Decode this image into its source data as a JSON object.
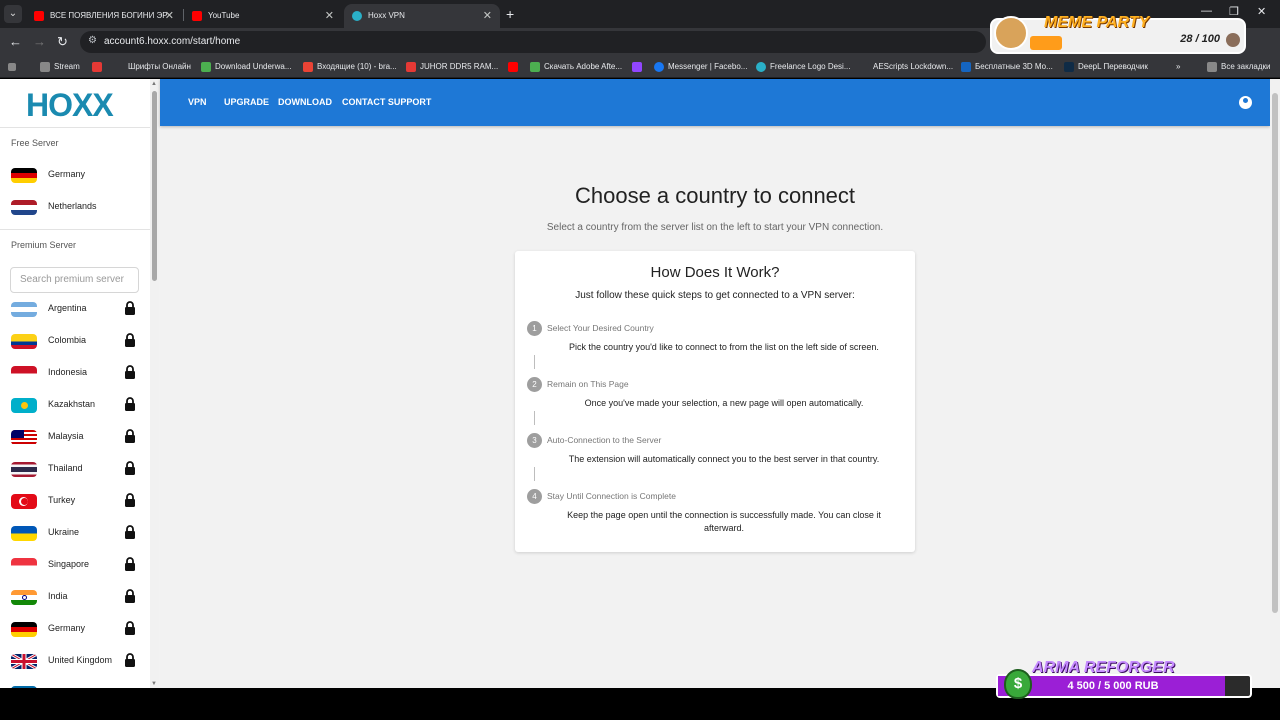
{
  "browser": {
    "tabs": [
      {
        "label": "ВСЕ ПОЯВЛЕНИЯ БОГИНИ ЭР",
        "fav_color": "#ff0000"
      },
      {
        "label": "YouTube",
        "fav_color": "#ff0000"
      },
      {
        "label": "Hoxx VPN",
        "fav_color": "#2ab0c8"
      }
    ],
    "url": "account6.hoxx.com/start/home",
    "bookmarks": [
      {
        "label": "Stream",
        "color": "#888888"
      },
      {
        "label": "",
        "color": "#e53935"
      },
      {
        "label": "Шрифты Онлайн",
        "color": "#35363a"
      },
      {
        "label": "Download Underwa...",
        "color": "#4caf50"
      },
      {
        "label": "Входящие (10) - bra...",
        "color": "#ea4335"
      },
      {
        "label": "JUHOR DDR5 RAM...",
        "color": "#e53935"
      },
      {
        "label": "",
        "color": "#ff0000"
      },
      {
        "label": "Скачать Adobe Afte...",
        "color": "#4caf50"
      },
      {
        "label": "",
        "color": "#9146ff"
      },
      {
        "label": "Messenger | Facebo...",
        "color": "#1877f2"
      },
      {
        "label": "Freelance Logo Desi...",
        "color": "#2ab0c8"
      },
      {
        "label": "AEScripts Lockdown...",
        "color": "#35363a"
      },
      {
        "label": "Бесплатные 3D Мо...",
        "color": "#1565c0"
      },
      {
        "label": "DeepL Переводчик",
        "color": "#0f2b46"
      }
    ],
    "all_bookmarks": "Все закладки"
  },
  "overlay": {
    "meme_title": "MEME PARTY",
    "meme_count": "28 / 100",
    "arma_title": "ARMA REFORGER",
    "arma_value": "4 500 / 5 000 RUB",
    "arma_progress": 0.9
  },
  "sidebar": {
    "logo": "HOXX",
    "free_label": "Free Server",
    "free_servers": [
      {
        "name": "Germany",
        "flag": "de"
      },
      {
        "name": "Netherlands",
        "flag": "nl"
      }
    ],
    "premium_label": "Premium Server",
    "search_placeholder": "Search premium server",
    "premium_servers": [
      {
        "name": "Argentina",
        "flag": "ar"
      },
      {
        "name": "Colombia",
        "flag": "co"
      },
      {
        "name": "Indonesia",
        "flag": "id"
      },
      {
        "name": "Kazakhstan",
        "flag": "kz"
      },
      {
        "name": "Malaysia",
        "flag": "my"
      },
      {
        "name": "Thailand",
        "flag": "th"
      },
      {
        "name": "Turkey",
        "flag": "tr"
      },
      {
        "name": "Ukraine",
        "flag": "ua"
      },
      {
        "name": "Singapore",
        "flag": "sg"
      },
      {
        "name": "India",
        "flag": "in"
      },
      {
        "name": "Germany",
        "flag": "de"
      },
      {
        "name": "United Kingdom",
        "flag": "gb"
      }
    ]
  },
  "nav": {
    "links": [
      "VPN",
      "UPGRADE",
      "DOWNLOAD",
      "CONTACT SUPPORT"
    ]
  },
  "main": {
    "title": "Choose a country to connect",
    "subtitle": "Select a country from the server list on the left to start your VPN connection.",
    "card_title": "How Does It Work?",
    "card_subtitle": "Just follow these quick steps to get connected to a VPN server:",
    "steps": [
      {
        "num": "1",
        "title": "Select Your Desired Country",
        "desc": "Pick the country you'd like to connect to from the list on the left side of screen."
      },
      {
        "num": "2",
        "title": "Remain on This Page",
        "desc": "Once you've made your selection, a new page will open automatically."
      },
      {
        "num": "3",
        "title": "Auto-Connection to the Server",
        "desc": "The extension will automatically connect you to the best server in that country."
      },
      {
        "num": "4",
        "title": "Stay Until Connection is Complete",
        "desc": "Keep the page open until the connection is successfully made. You can close it afterward."
      }
    ]
  }
}
